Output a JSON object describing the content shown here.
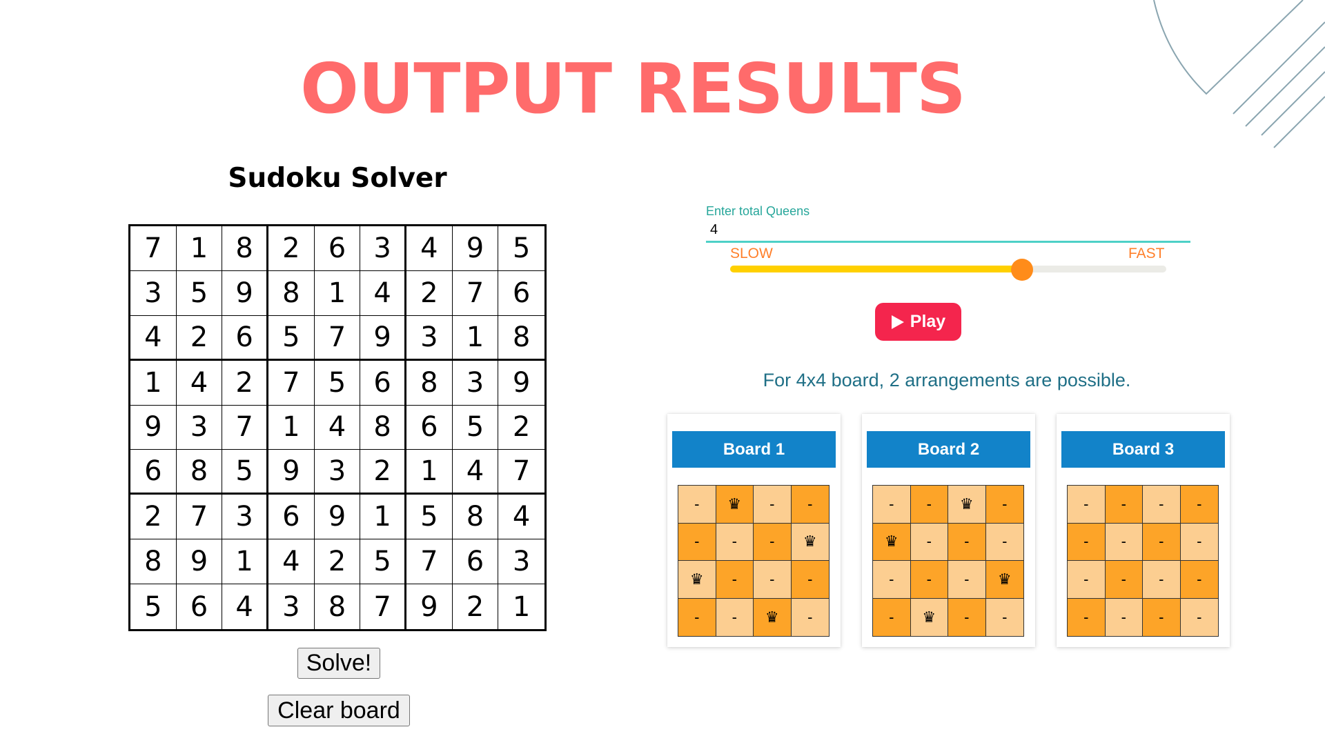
{
  "page": {
    "title": "OUTPUT RESULTS"
  },
  "sudoku": {
    "title": "Sudoku Solver",
    "grid": [
      [
        7,
        1,
        8,
        2,
        6,
        3,
        4,
        9,
        5
      ],
      [
        3,
        5,
        9,
        8,
        1,
        4,
        2,
        7,
        6
      ],
      [
        4,
        2,
        6,
        5,
        7,
        9,
        3,
        1,
        8
      ],
      [
        1,
        4,
        2,
        7,
        5,
        6,
        8,
        3,
        9
      ],
      [
        9,
        3,
        7,
        1,
        4,
        8,
        6,
        5,
        2
      ],
      [
        6,
        8,
        5,
        9,
        3,
        2,
        1,
        4,
        7
      ],
      [
        2,
        7,
        3,
        6,
        9,
        1,
        5,
        8,
        4
      ],
      [
        8,
        9,
        1,
        4,
        2,
        5,
        7,
        6,
        3
      ],
      [
        5,
        6,
        4,
        3,
        8,
        7,
        9,
        2,
        1
      ]
    ],
    "solve_label": "Solve!",
    "clear_label": "Clear board"
  },
  "queens": {
    "input_label": "Enter total Queens",
    "input_value": "4",
    "slow_label": "SLOW",
    "fast_label": "FAST",
    "speed": 0.67,
    "play_label": "Play",
    "result_text": "For 4x4 board, 2 arrangements are possible.",
    "empty_symbol": "-",
    "queen_symbol": "♛",
    "boards": [
      {
        "label": "Board 1",
        "queens": [
          1,
          3,
          0,
          2
        ]
      },
      {
        "label": "Board 2",
        "queens": [
          2,
          0,
          3,
          1
        ]
      },
      {
        "label": "Board 3",
        "queens": [
          -1,
          -1,
          -1,
          -1
        ]
      }
    ]
  },
  "colors": {
    "title": "#ff6b6b",
    "board_header": "#1283c9",
    "cell_light": "#fcce91",
    "cell_dark": "#fda428",
    "play_button": "#f4254d",
    "slider_fill": "#ffd000",
    "slider_thumb": "#ff8c1a",
    "input_underline": "#4dd0c7",
    "decor_lines": "#8aa5b0"
  }
}
